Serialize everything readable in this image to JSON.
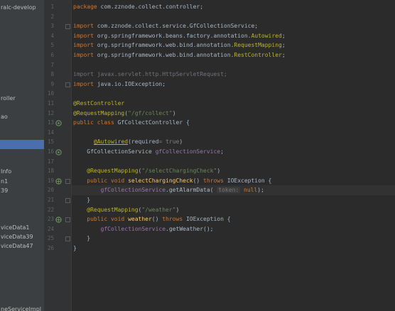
{
  "sidebar": {
    "items": [
      {
        "label": "ralc-develop",
        "selected": false
      },
      {
        "label": "roller",
        "selected": false
      },
      {
        "label": "ao",
        "selected": false
      },
      {
        "label": "",
        "selected": true
      },
      {
        "label": "Info",
        "selected": false
      },
      {
        "label": "n1",
        "selected": false
      },
      {
        "label": "39",
        "selected": false
      },
      {
        "label": "viceData1",
        "selected": false
      },
      {
        "label": "viceData39",
        "selected": false
      },
      {
        "label": "viceData47",
        "selected": false
      },
      {
        "label": "neServiceImpl",
        "selected": false
      }
    ]
  },
  "gutter": {
    "line_numbers": [
      "1",
      "2",
      "3",
      "4",
      "5",
      "6",
      "7",
      "8",
      "9",
      "10",
      "11",
      "12",
      "13",
      "14",
      "15",
      "16",
      "17",
      "18",
      "19",
      "20",
      "21",
      "22",
      "23",
      "24",
      "25",
      "26"
    ]
  },
  "code": {
    "l1": {
      "kw": "package",
      "rest": " com.zznode.collect.controller;"
    },
    "l3": {
      "kw": "import",
      "rest": " com.zznode.collect.service.GfCollectionService;"
    },
    "l4": {
      "kw": "import",
      "rest": " org.springframework.beans.factory.annotation.",
      "ann": "Autowired",
      "end": ";"
    },
    "l5": {
      "kw": "import",
      "rest": " org.springframework.web.bind.annotation.",
      "ann": "RequestMapping",
      "end": ";"
    },
    "l6": {
      "kw": "import",
      "rest": " org.springframework.web.bind.annotation.",
      "ann": "RestController",
      "end": ";"
    },
    "l8": {
      "text": "import javax.servlet.http.HttpServletRequest;"
    },
    "l9": {
      "kw": "import",
      "rest": " java.io.IOException;"
    },
    "l11": {
      "ann": "@RestController"
    },
    "l12": {
      "ann": "@RequestMapping",
      "open": "(",
      "str": "\"/gf/collect\"",
      "close": ")"
    },
    "l13": {
      "kw": "public class",
      "rest": " GfCollectController {"
    },
    "l15": {
      "ann": "@Autowired",
      "open": "(",
      "param": "required",
      "hint": "= true",
      "close": ")"
    },
    "l16": {
      "type": "GfCollectionService ",
      "field": "gfCollectionService",
      "end": ";"
    },
    "l18": {
      "ann": "@RequestMapping",
      "open": "(",
      "str": "\"/selectChargingCheck\"",
      "close": ")"
    },
    "l19": {
      "kw1": "public void",
      "fn": " selectChargingCheck",
      "mid": "() ",
      "kw2": "throws",
      "rest": " IOException {"
    },
    "l20": {
      "field": "gfCollectionService",
      "call": ".getAlarmData( ",
      "hint": "token:",
      "kw": " null",
      "end": ");"
    },
    "l21": {
      "text": "}"
    },
    "l22": {
      "ann": "@RequestMapping",
      "open": "(",
      "str": "\"/weather\"",
      "close": ")"
    },
    "l23": {
      "kw1": "public void",
      "fn": " weather",
      "mid": "() ",
      "kw2": "throws",
      "rest": " IOException {"
    },
    "l24": {
      "field": "gfCollectionService",
      "call": ".getWeather();"
    },
    "l25": {
      "text": "}"
    },
    "l26": {
      "text": "}"
    }
  },
  "colors": {
    "background": "#2b2b2b",
    "keyword": "#cc7832",
    "annotation": "#bbb529",
    "string": "#6a8759",
    "field": "#9876aa",
    "function": "#ffc66d",
    "text": "#a9b7c6",
    "sidebar_selected": "#4b6eaf"
  },
  "icons": {
    "spring_bean": "spring-bean-icon",
    "web_mapping": "web-mapping-icon"
  }
}
